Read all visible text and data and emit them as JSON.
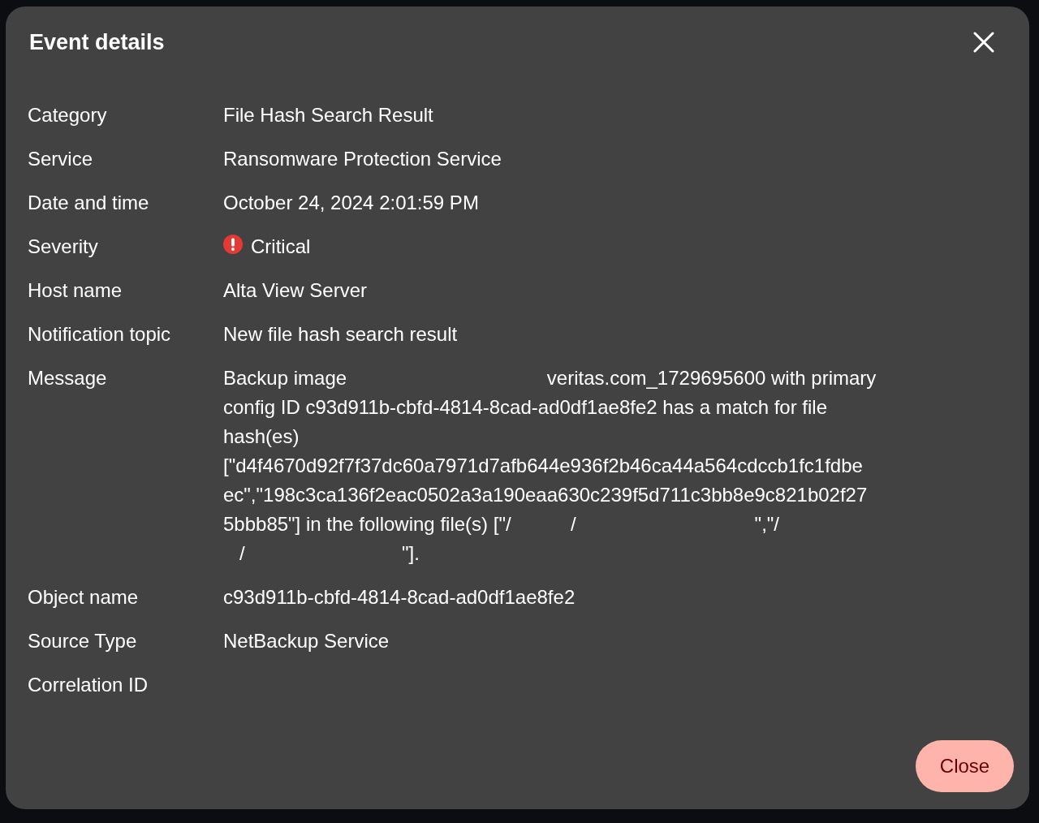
{
  "dialog": {
    "title": "Event details",
    "close_button": "Close"
  },
  "details": [
    {
      "kind": "text",
      "label": "Category",
      "value": "File Hash Search Result"
    },
    {
      "kind": "text",
      "label": "Service",
      "value": "Ransomware Protection Service"
    },
    {
      "kind": "text",
      "label": "Date and time",
      "value": "October 24, 2024 2:01:59 PM"
    },
    {
      "kind": "severity",
      "label": "Severity",
      "value": "Critical"
    },
    {
      "kind": "text",
      "label": "Host name",
      "value": "Alta View Server"
    },
    {
      "kind": "text",
      "label": "Notification topic",
      "value": "New file hash search result"
    },
    {
      "kind": "message",
      "label": "Message",
      "lines": [
        "Backup image                                     veritas.com_1729695600 with primary",
        "config ID c93d911b-cbfd-4814-8cad-ad0df1ae8fe2 has a match for file",
        "hash(es)",
        "[\"d4f4670d92f7f37dc60a7971d7afb644e936f2b46ca44a564cdccb1fc1fdbe",
        "ec\",\"198c3ca136f2eac0502a3a190eaa630c239f5d711c3bb8e9c821b02f27",
        "5bbb85\"] in the following file(s) [\"/           /                                 \",\"/",
        "   /                             \"]."
      ]
    },
    {
      "kind": "text",
      "label": "Object name",
      "value": "c93d911b-cbfd-4814-8cad-ad0df1ae8fe2"
    },
    {
      "kind": "text",
      "label": "Source Type",
      "value": "NetBackup Service"
    },
    {
      "kind": "text",
      "label": "Correlation ID"
    }
  ]
}
